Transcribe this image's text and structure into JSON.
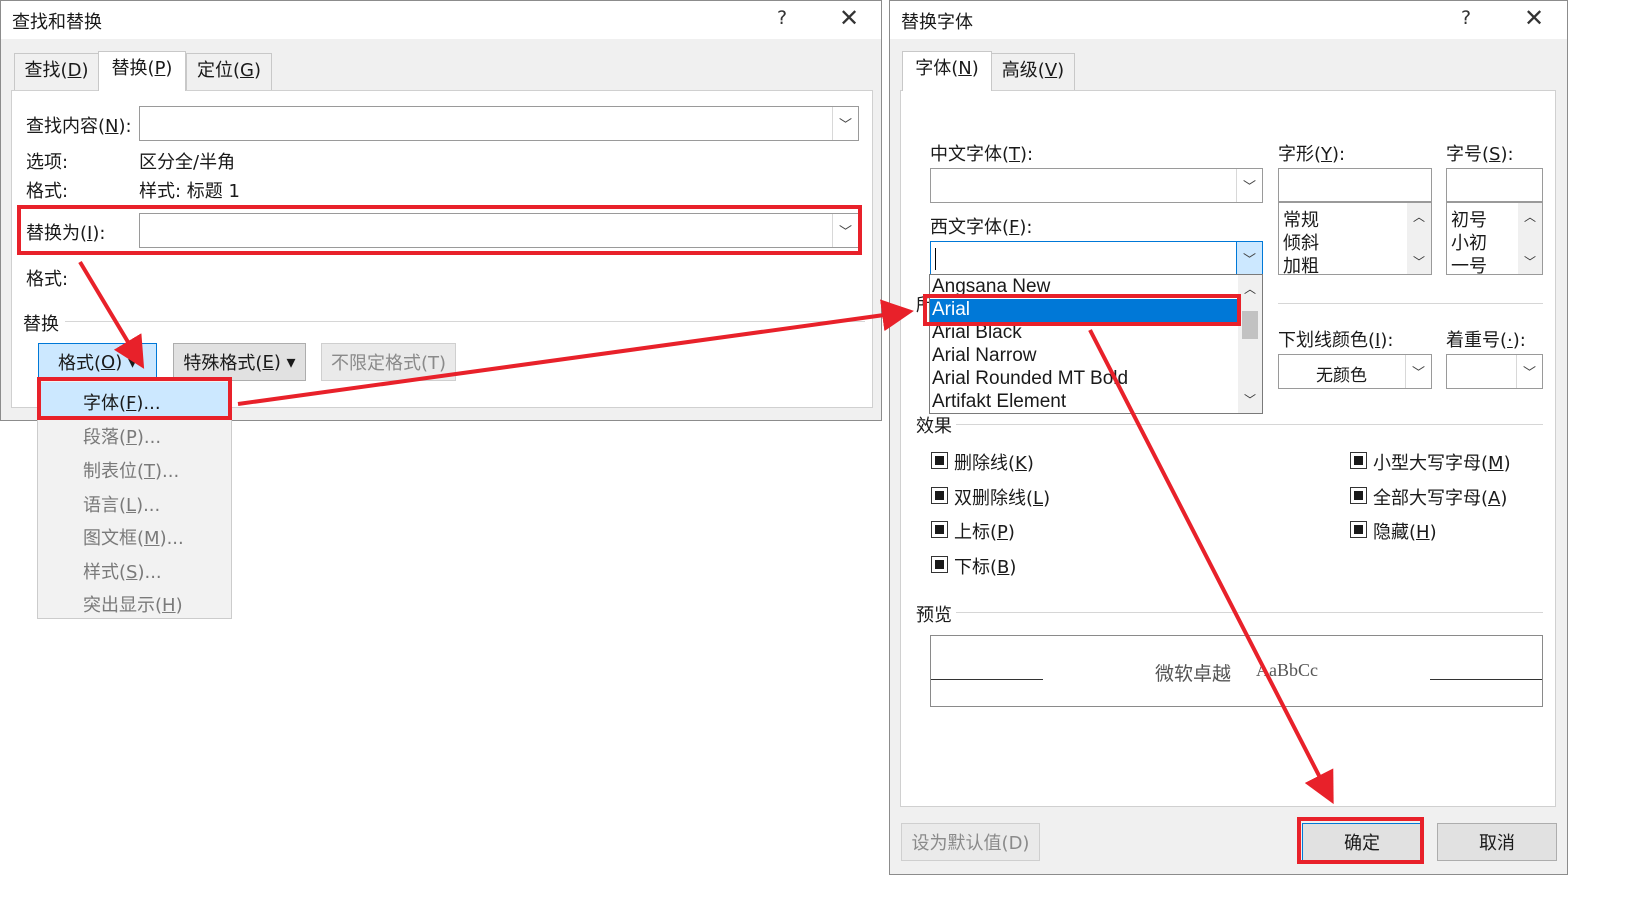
{
  "find_replace": {
    "title": "查找和替换",
    "help": "?",
    "close": "✕",
    "tabs": [
      {
        "label": "查找(",
        "key": "D",
        "end": ")"
      },
      {
        "label": "替换(",
        "key": "P",
        "end": ")"
      },
      {
        "label": "定位(",
        "key": "G",
        "end": ")"
      }
    ],
    "find_label": {
      "label": "查找内容(",
      "key": "N",
      "end": "):"
    },
    "find_value": "",
    "options_label": "选项:",
    "options_value": "区分全/半角",
    "format_label": "格式:",
    "format_value": "样式: 标题 1",
    "replace_label": {
      "label": "替换为(",
      "key": "I",
      "end": "):"
    },
    "replace_value": "",
    "replace_format_label": "格式:",
    "section_label": "替换",
    "buttons": {
      "format": {
        "label": "格式(",
        "key": "O",
        "end": ") ▾"
      },
      "special": {
        "label": "特殊格式(",
        "key": "E",
        "end": ") ▾"
      },
      "no_format": "不限定格式(T)"
    },
    "menu": [
      {
        "label": "字体(",
        "key": "F",
        "end": ")..."
      },
      {
        "label": "段落(",
        "key": "P",
        "end": ")..."
      },
      {
        "label": "制表位(",
        "key": "T",
        "end": ")..."
      },
      {
        "label": "语言(",
        "key": "L",
        "end": ")..."
      },
      {
        "label": "图文框(",
        "key": "M",
        "end": ")..."
      },
      {
        "label": "样式(",
        "key": "S",
        "end": ")..."
      },
      {
        "label": "突出显示(",
        "key": "H",
        "end": ")"
      }
    ]
  },
  "font_dialog": {
    "title": "替换字体",
    "help": "?",
    "close": "✕",
    "tabs": [
      {
        "label": "字体(",
        "key": "N",
        "end": ")"
      },
      {
        "label": "高级(",
        "key": "V",
        "end": ")"
      }
    ],
    "chinese_font_label": {
      "label": "中文字体(",
      "key": "T",
      "end": "):"
    },
    "chinese_font_value": "",
    "style_label": {
      "label": "字形(",
      "key": "Y",
      "end": "):"
    },
    "size_label": {
      "label": "字号(",
      "key": "S",
      "end": "):"
    },
    "style_value": "",
    "size_value": "",
    "styles": [
      "常规",
      "倾斜",
      "加粗"
    ],
    "sizes": [
      "初号",
      "小初",
      "一号"
    ],
    "western_font_label": {
      "label": "西文字体(",
      "key": "F",
      "end": "):"
    },
    "western_font_value": "",
    "fonts": [
      "Angsana New",
      "Arial",
      "Arial Black",
      "Arial Narrow",
      "Arial Rounded MT Bold",
      "Artifakt Element"
    ],
    "selected_font": "Arial",
    "hidden_label_fragment": "所",
    "underline_color_label": {
      "label": "下划线颜色(",
      "key": "I",
      "end": "):"
    },
    "underline_color_value": "无颜色",
    "emphasis_label": {
      "label": "着重号(",
      "key": "·",
      "end": "):"
    },
    "emphasis_value": "",
    "effects_label": "效果",
    "effects": [
      {
        "label": "删除线(",
        "key": "K",
        "end": ")"
      },
      {
        "label": "双删除线(",
        "key": "L",
        "end": ")"
      },
      {
        "label": "上标(",
        "key": "P",
        "end": ")"
      },
      {
        "label": "下标(",
        "key": "B",
        "end": ")"
      },
      {
        "label": "小型大写字母(",
        "key": "M",
        "end": ")"
      },
      {
        "label": "全部大写字母(",
        "key": "A",
        "end": ")"
      },
      {
        "label": "隐藏(",
        "key": "H",
        "end": ")"
      }
    ],
    "preview_label": "预览",
    "preview_text_cn": "微软卓越",
    "preview_text_en": "AaBbCc",
    "buttons": {
      "set_default": "设为默认值(D)",
      "ok": "确定",
      "cancel": "取消"
    }
  },
  "colors": {
    "annotation_red": "#e8212a",
    "selection_blue": "#0078d7",
    "menu_highlight": "#cce8ff"
  }
}
